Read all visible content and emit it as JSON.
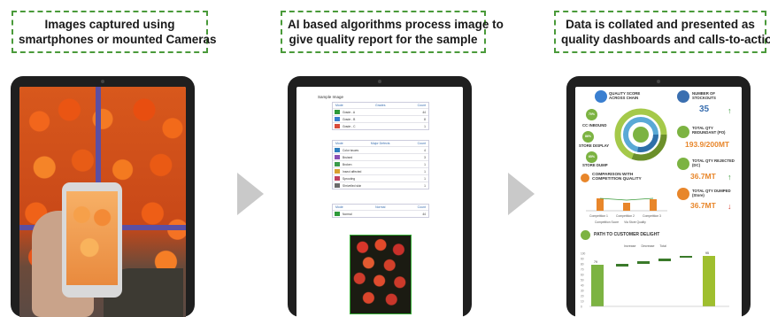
{
  "captions": [
    {
      "line1": "Images captured using",
      "line2": "smartphones or mounted Cameras"
    },
    {
      "line1": "AI based algorithms process image to",
      "line2": "give quality report for the sample"
    },
    {
      "line1": "Data is collated and presented as",
      "line2": "quality dashboards and calls-to-action"
    }
  ],
  "colors": {
    "caption_border": "#4a9a3a",
    "arrow": "#c9c9c9",
    "tablet": "#1f1f1f"
  },
  "report": {
    "title": "Sample Image",
    "table1": {
      "headers": [
        "Mode",
        "Grades",
        "Count"
      ],
      "rows": [
        {
          "label": "Grade - A",
          "value": "44",
          "color": "#2e9a3a"
        },
        {
          "label": "Grade - B",
          "value": "8",
          "color": "#3a7fd0"
        },
        {
          "label": "Grade - C",
          "value": "1",
          "color": "#d84a3a"
        }
      ]
    },
    "table2": {
      "headers": [
        "Mode",
        "Major Defects",
        "Count"
      ],
      "rows": [
        {
          "label": "Color issues",
          "value": "4",
          "color": "#2e7fbf"
        },
        {
          "label": "Bruised",
          "value": "3",
          "color": "#8a4fb5"
        },
        {
          "label": "Broken",
          "value": "1",
          "color": "#3a9a4a"
        },
        {
          "label": "Insect affected",
          "value": "1",
          "color": "#d8a030"
        },
        {
          "label": "Sprouting",
          "value": "1",
          "color": "#c04060"
        },
        {
          "label": "Shrivelled skin",
          "value": "1",
          "color": "#6a6a6a"
        }
      ]
    },
    "table3": {
      "headers": [
        "Mode",
        "Normal",
        "Count"
      ],
      "rows": [
        {
          "label": "Normal",
          "value": "44",
          "color": "#2e9a3a"
        }
      ]
    }
  },
  "dashboard": {
    "quality_score_label": "QUALITY SCORE ACROSS CHAIN",
    "chain_labels": [
      "CC INBOUND",
      "STORE DISPLAY",
      "STORE DUMP"
    ],
    "chain_values": [
      "70%",
      "86%",
      "65%"
    ],
    "num_stockouts_label": "NUMBER OF STOCKOUTS",
    "num_stockouts_value": "35",
    "redundant_label": "TOTAL QTY REDUNDANT (PO)",
    "redundant_value": "193.9/200MT",
    "rejected_label": "TOTAL QTY REJECTED (DC)",
    "rejected_value": "36.7MT",
    "dumped_label": "TOTAL QTY DUMPED (Store)",
    "dumped_value": "36.7MT",
    "comparison_title": "COMPARISON WITH COMPETITION QUALITY",
    "comparison_categories": [
      "Competition 1",
      "Competition 2",
      "Competition 3"
    ],
    "comparison_legend": [
      "Competition Score",
      "Via Store Quality"
    ],
    "path_title": "PATH TO CUSTOMER DELIGHT",
    "path_legend": [
      "Increase",
      "Decrease",
      "Total"
    ],
    "path_values": [
      "79",
      "95"
    ],
    "path_axis": [
      "100",
      "90",
      "80",
      "70",
      "60",
      "50",
      "40",
      "30",
      "20",
      "10",
      "0"
    ]
  }
}
